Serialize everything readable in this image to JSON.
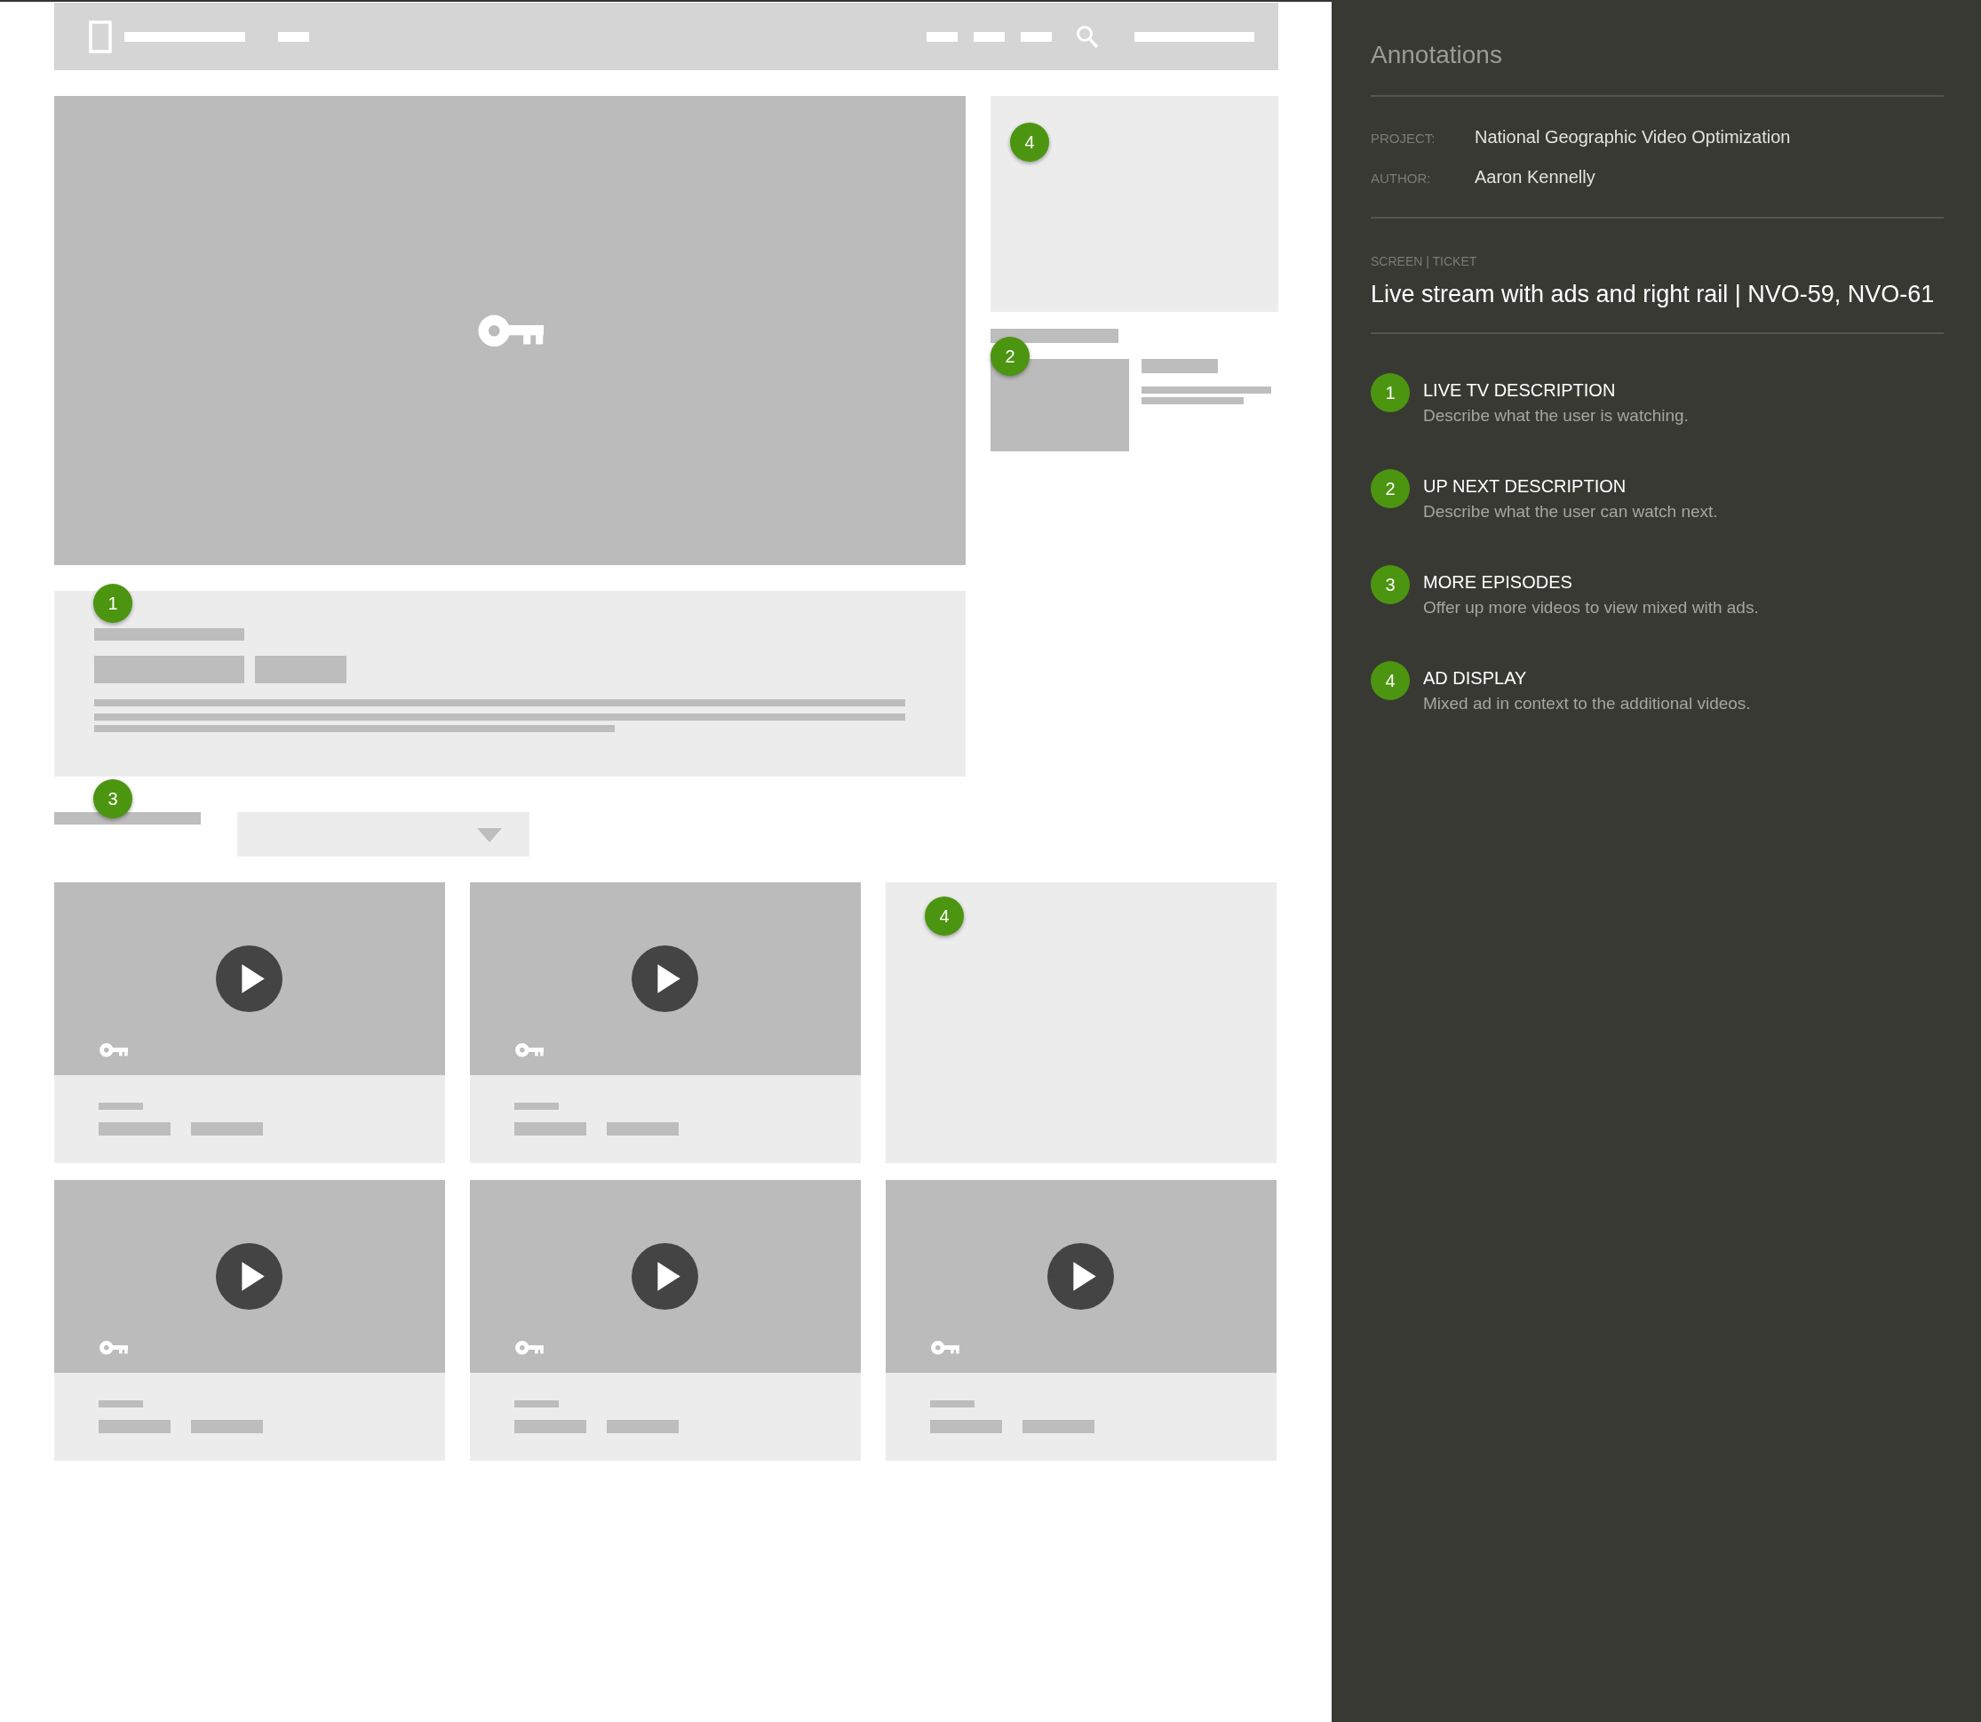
{
  "wireframe": {
    "hero_ad": {
      "badge": "4"
    },
    "up_next": {
      "badge": "2"
    },
    "live_description": {
      "badge": "1"
    },
    "more_episodes": {
      "badge": "3"
    },
    "cards": [
      {
        "kind": "video"
      },
      {
        "kind": "video"
      },
      {
        "kind": "ad",
        "badge": "4"
      },
      {
        "kind": "video"
      },
      {
        "kind": "video"
      },
      {
        "kind": "video"
      }
    ]
  },
  "annotations": {
    "title": "Annotations",
    "meta": [
      {
        "label": "PROJECT:",
        "value": "National Geographic Video Optimization"
      },
      {
        "label": "AUTHOR:",
        "value": "Aaron Kennelly"
      }
    ],
    "screen_label": "SCREEN | TICKET",
    "screen_title": "Live stream with ads and right rail | NVO-59, NVO-61",
    "items": [
      {
        "number": "1",
        "title": "LIVE TV DESCRIPTION",
        "description": "Describe what the user is watching."
      },
      {
        "number": "2",
        "title": "UP NEXT DESCRIPTION",
        "description": "Describe what the user can watch next."
      },
      {
        "number": "3",
        "title": "MORE EPISODES",
        "description": "Offer up more videos to view mixed with ads."
      },
      {
        "number": "4",
        "title": "AD DISPLAY",
        "description": "Mixed ad in context to the additional videos."
      }
    ]
  }
}
